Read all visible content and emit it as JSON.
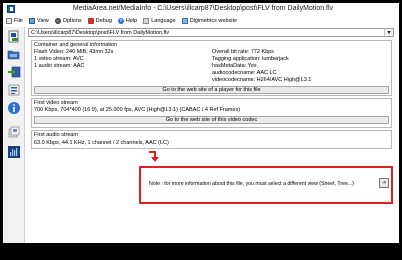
{
  "window": {
    "title": "MediaArea.net/MediaInfo - C:\\Users\\illcarp87\\Desktop\\post\\FLV from DailyMotion.flv"
  },
  "menu": {
    "file": "File",
    "view": "View",
    "options": "Options",
    "debug": "Debug",
    "help": "Help",
    "language": "Language",
    "digimetrics": "Digimetrics website"
  },
  "file_select": {
    "value": "C:\\Users\\illcarp87\\Desktop\\post\\FLV from DailyMotion.flv"
  },
  "general": {
    "title": "Container and general information",
    "left_lines": [
      "Flash Video: 240 MiB, 43mn 32s",
      "1 video stream: AVC",
      "1 audio stream: AAC"
    ],
    "right_lines": [
      "Overall bit rate: 772 Kbps",
      "Tagging application: lumberjack",
      "hasMetaData: Yes",
      "audiocodecname: AAC LC",
      "videocodecname: H264/AVC High@L3.1"
    ],
    "link_label": "Go to the web site of a player for this file"
  },
  "video": {
    "title": "First video stream",
    "line": "700 Kbps, 704*400 (16:9), at 25.000 fps, AVC (High@L3.1) (CABAC / 4 Ref Frames)",
    "link_label": "Go to the web site of this video codec"
  },
  "audio": {
    "title": "First audio stream",
    "line": "63.0 Kbps, 44.1 KHz, 1 channel  / 2 channels, AAC (LC)"
  },
  "note": {
    "text": "Note : for more information about this file, you must select a different view (Sheet, Tree...)",
    "button_label": "->"
  },
  "colors": {
    "annotation_red": "#e02020"
  }
}
